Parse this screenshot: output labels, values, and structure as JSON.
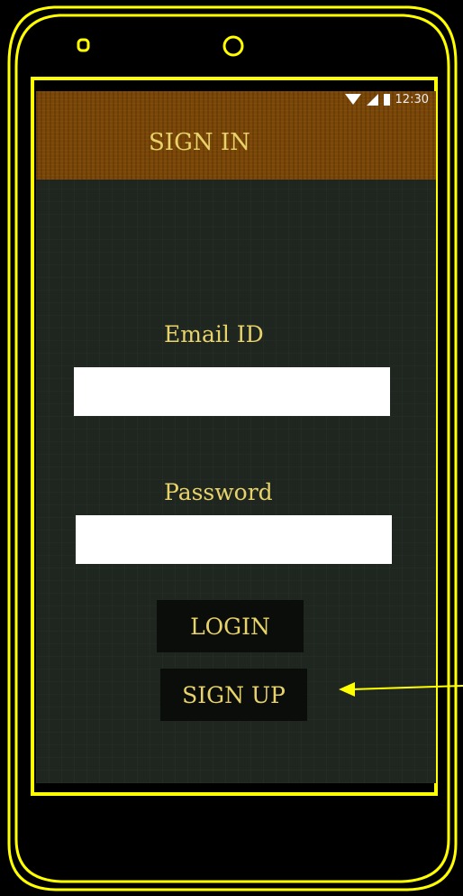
{
  "status_bar": {
    "time": "12:30",
    "icons": [
      "wifi-icon",
      "signal-icon",
      "battery-icon"
    ]
  },
  "app_bar": {
    "title": "SIGN IN"
  },
  "form": {
    "email_label": "Email ID",
    "email_value": "",
    "password_label": "Password",
    "password_value": ""
  },
  "buttons": {
    "login_label": "LOGIN",
    "signup_label": "SIGN UP"
  },
  "colors": {
    "outline": "#ffff00",
    "app_bar": "#7a4708",
    "screen_bg": "#1f2620",
    "text_accent": "#e8d36a",
    "button_bg": "#0b0d0a"
  }
}
